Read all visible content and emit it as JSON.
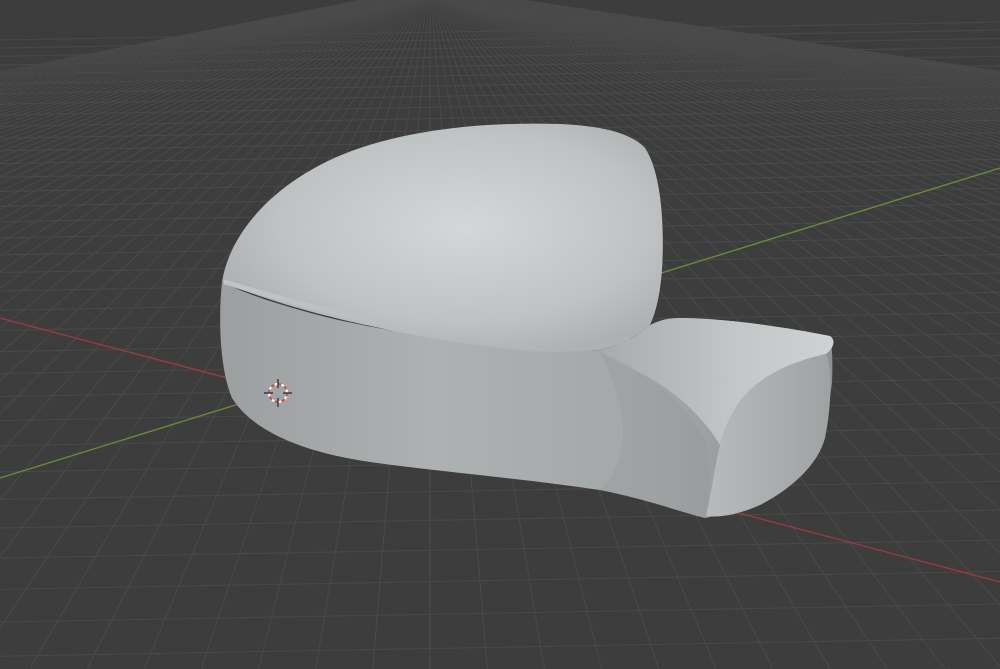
{
  "viewport": {
    "mode": "3d-viewport",
    "background_color": "#3d3d3d",
    "grid_line_color": "#4a4a4a",
    "x_axis_color": "#9a3a45",
    "y_axis_color": "#6a8a3a",
    "model_color": "#b9bcbd",
    "model_highlight_color": "#d3d6d7",
    "model_shadow_color": "#8b8e8f",
    "cursor_color": "#d64a4a"
  },
  "scene": {
    "object": "mirror-cap-mesh",
    "cursor_icon": "3d-cursor-icon"
  }
}
